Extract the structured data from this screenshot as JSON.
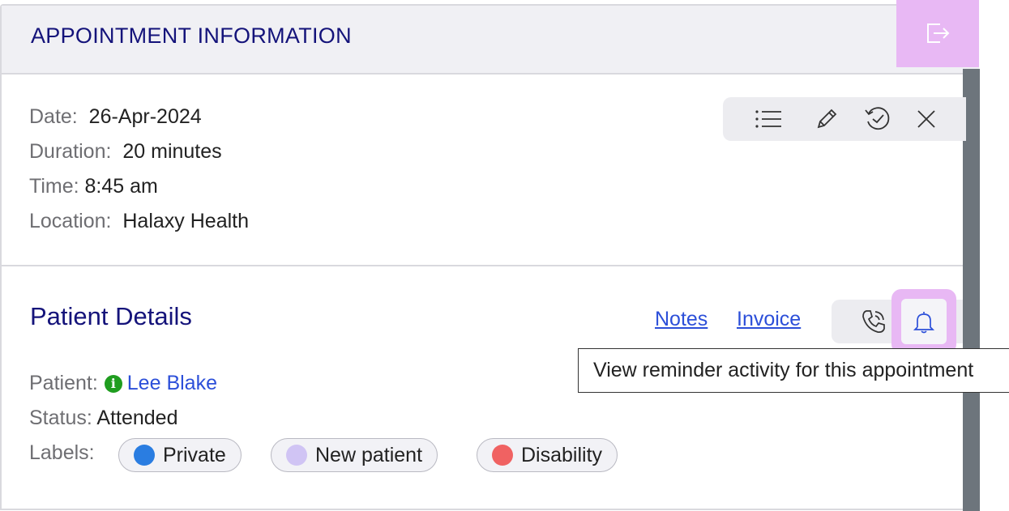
{
  "header": {
    "title": "APPOINTMENT INFORMATION",
    "exit_icon": "exit-icon",
    "accent": "#e8b8f4"
  },
  "appointment": {
    "date_label": "Date:",
    "date_value": "26-Apr-2024",
    "duration_label": "Duration:",
    "duration_value": "20 minutes",
    "time_label": "Time:",
    "time_value": "8:45 am",
    "location_label": "Location:",
    "location_value": "Halaxy Health",
    "actions": [
      "list-icon",
      "pencil-icon",
      "history-icon",
      "close-icon"
    ]
  },
  "patient": {
    "title": "Patient Details",
    "notes_link": "Notes",
    "invoice_link": "Invoice",
    "contact_icons": [
      "phone-call-icon",
      "bell-icon"
    ],
    "tooltip": "View reminder activity for this appointment",
    "patient_label": "Patient:",
    "patient_name": "Lee Blake",
    "status_label": "Status:",
    "status_value": "Attended",
    "labels_label": "Labels:",
    "labels": [
      {
        "name": "Private",
        "color": "#2a7de1"
      },
      {
        "name": "New patient",
        "color": "#d0c4f4"
      },
      {
        "name": "Disability",
        "color": "#f06262"
      }
    ]
  }
}
